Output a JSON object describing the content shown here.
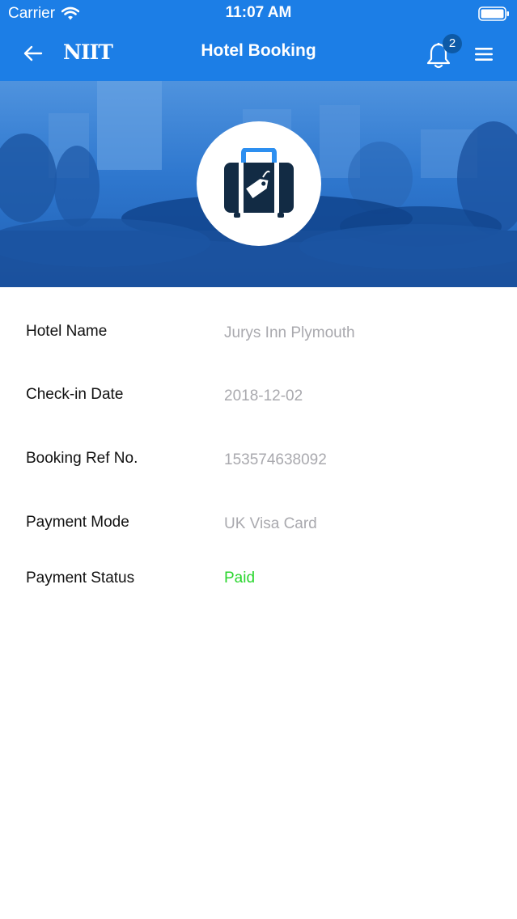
{
  "status_bar": {
    "carrier": "Carrier",
    "time": "11:07 AM"
  },
  "nav": {
    "title": "Hotel Booking",
    "brand": "NIIT",
    "notification_count": "2",
    "back_icon": "arrow-left-icon",
    "bell_icon": "bell-icon",
    "menu_icon": "hamburger-menu-icon"
  },
  "hero": {
    "icon": "luggage-tag-icon"
  },
  "booking": {
    "hotel_name_label": "Hotel Name",
    "hotel_name_value": "Jurys Inn Plymouth",
    "checkin_label": "Check-in Date",
    "checkin_value": "2018-12-02",
    "ref_label": "Booking Ref No.",
    "ref_value": "153574638092",
    "payment_mode_label": "Payment Mode",
    "payment_mode_value": "UK Visa Card",
    "payment_status_label": "Payment Status",
    "payment_status_value": "Paid"
  },
  "colors": {
    "primary": "#1c7ee6",
    "badge": "#0d5aa7",
    "paid": "#2ad62e",
    "value_text": "#a9a9ae"
  }
}
